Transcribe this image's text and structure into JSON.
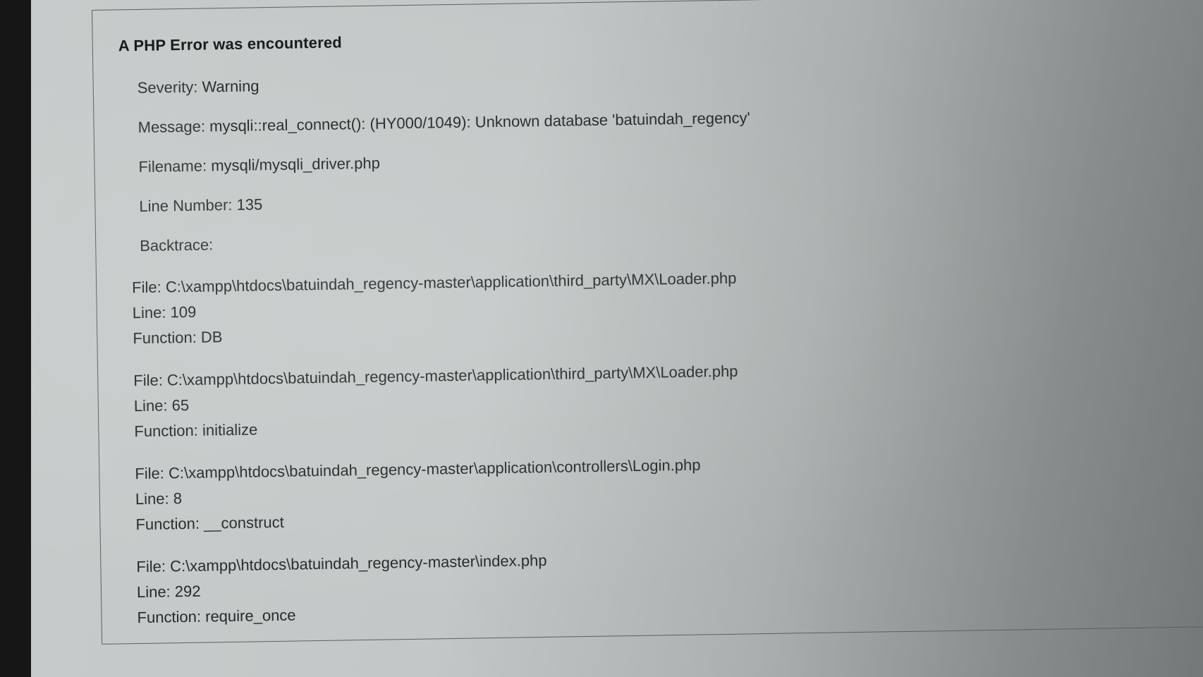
{
  "error": {
    "title": "A PHP Error was encountered",
    "severity": {
      "label": "Severity:",
      "value": "Warning"
    },
    "message": {
      "label": "Message:",
      "value": "mysqli::real_connect(): (HY000/1049): Unknown database 'batuindah_regency'"
    },
    "filename": {
      "label": "Filename:",
      "value": "mysqli/mysqli_driver.php"
    },
    "line_number": {
      "label": "Line Number:",
      "value": "135"
    },
    "backtrace_label": "Backtrace:",
    "frames": [
      {
        "file": "File: C:\\xampp\\htdocs\\batuindah_regency-master\\application\\third_party\\MX\\Loader.php",
        "line": "Line: 109",
        "function": "Function: DB"
      },
      {
        "file": "File: C:\\xampp\\htdocs\\batuindah_regency-master\\application\\third_party\\MX\\Loader.php",
        "line": "Line: 65",
        "function": "Function: initialize"
      },
      {
        "file": "File: C:\\xampp\\htdocs\\batuindah_regency-master\\application\\controllers\\Login.php",
        "line": "Line: 8",
        "function": "Function: __construct"
      },
      {
        "file": "File: C:\\xampp\\htdocs\\batuindah_regency-master\\index.php",
        "line": "Line: 292",
        "function": "Function: require_once"
      }
    ]
  }
}
